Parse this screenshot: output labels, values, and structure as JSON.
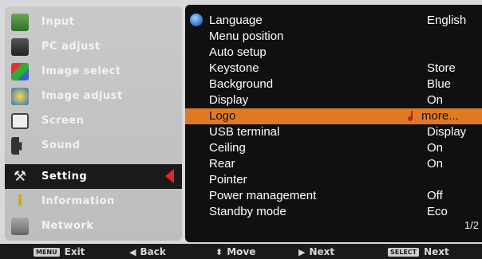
{
  "sidebar": {
    "items": [
      {
        "label": "Input",
        "icon": "input-icon"
      },
      {
        "label": "PC adjust",
        "icon": "pc-adjust-icon"
      },
      {
        "label": "Image select",
        "icon": "image-select-icon"
      },
      {
        "label": "Image adjust",
        "icon": "image-adjust-icon"
      },
      {
        "label": "Screen",
        "icon": "screen-icon"
      },
      {
        "label": "Sound",
        "icon": "sound-icon"
      },
      {
        "label": "Setting",
        "icon": "setting-icon"
      },
      {
        "label": "Information",
        "icon": "information-icon"
      },
      {
        "label": "Network",
        "icon": "network-icon"
      }
    ],
    "active_index": 6
  },
  "settings": {
    "rows": [
      {
        "name": "Language",
        "value": "English"
      },
      {
        "name": "Menu position",
        "value": ""
      },
      {
        "name": "Auto setup",
        "value": ""
      },
      {
        "name": "Keystone",
        "value": "Store"
      },
      {
        "name": "Background",
        "value": "Blue"
      },
      {
        "name": "Display",
        "value": "On"
      },
      {
        "name": "Logo",
        "value": "more..."
      },
      {
        "name": "USB terminal",
        "value": "Display"
      },
      {
        "name": "Ceiling",
        "value": "On"
      },
      {
        "name": "Rear",
        "value": "On"
      },
      {
        "name": "Pointer",
        "value": ""
      },
      {
        "name": "Power management",
        "value": "Off"
      },
      {
        "name": "Standby mode",
        "value": "Eco"
      }
    ],
    "highlight_index": 6,
    "page": "1/2"
  },
  "bottom_bar": {
    "exit_badge": "MENU",
    "exit": "Exit",
    "back": "Back",
    "move": "Move",
    "next": "Next",
    "select_badge": "SELECT",
    "select_next": "Next"
  },
  "colors": {
    "highlight": "#e07a22",
    "active_arrow": "#e82323",
    "panel": "#101010"
  }
}
